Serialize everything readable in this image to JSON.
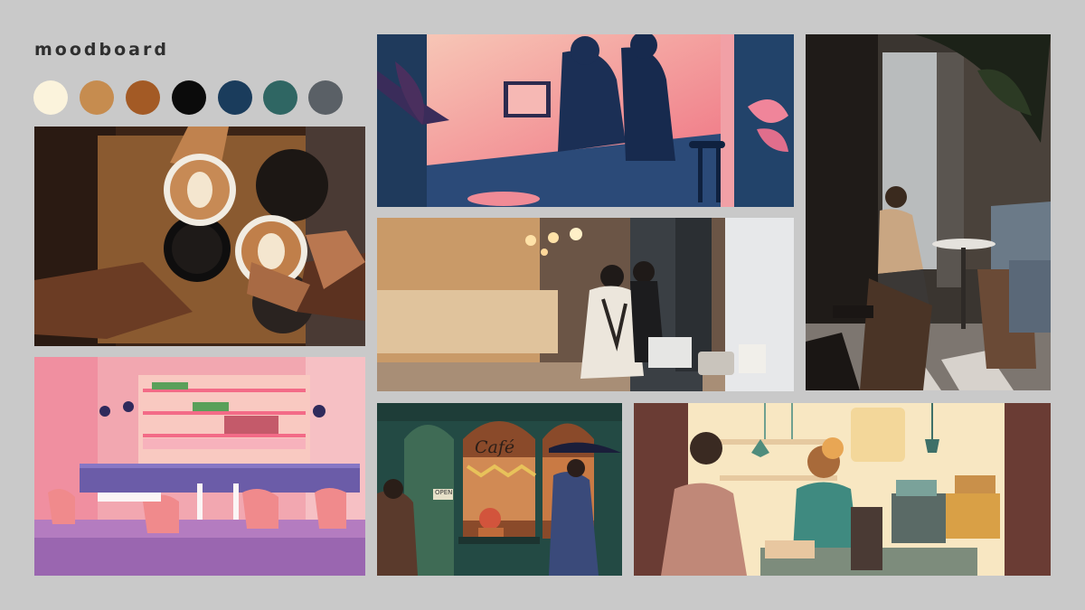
{
  "title": "moodboard",
  "palette": [
    "#fbf3dc",
    "#c68c4f",
    "#a35a25",
    "#0b0b0b",
    "#1a3c5c",
    "#2f6663",
    "#5a6066"
  ],
  "illustrations": {
    "cafe_sign": "Café",
    "door_sign": "OPEN"
  }
}
